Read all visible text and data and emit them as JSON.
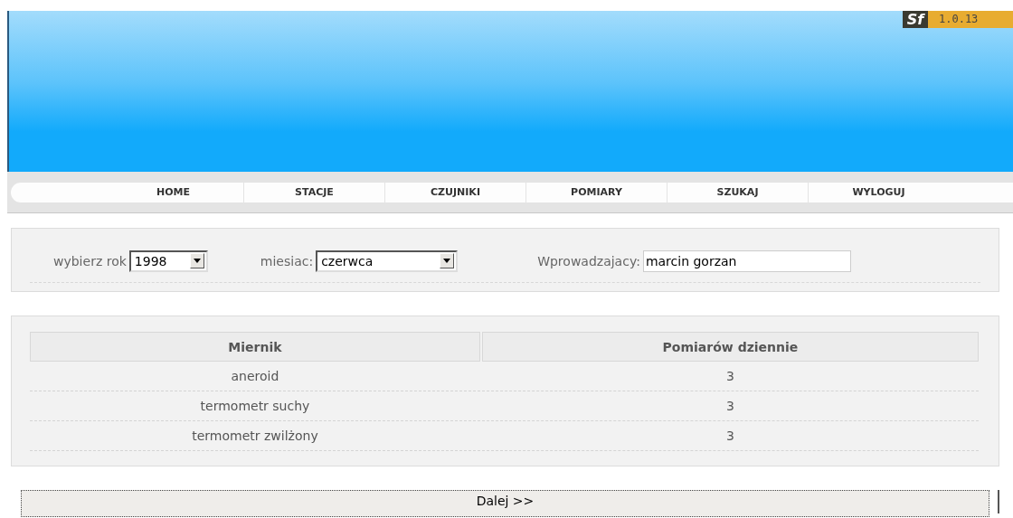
{
  "header": {
    "logo": "Sf",
    "version": "1.0.13"
  },
  "nav": [
    {
      "label": "HOME"
    },
    {
      "label": "STACJE"
    },
    {
      "label": "CZUJNIKI"
    },
    {
      "label": "POMIARY"
    },
    {
      "label": "SZUKAJ"
    },
    {
      "label": "WYLOGUJ"
    }
  ],
  "filters": {
    "year": {
      "label": "wybierz rok",
      "value": "1998"
    },
    "month": {
      "label": "miesiac:",
      "value": "czerwca"
    },
    "entered_by": {
      "label": "Wprowadzajacy:",
      "value": "marcin gorzan"
    }
  },
  "table": {
    "columns": [
      "Miernik",
      "Pomiarów dziennie"
    ],
    "rows": [
      [
        "aneroid",
        "3"
      ],
      [
        "termometr suchy",
        "3"
      ],
      [
        "termometr zwilżony",
        "3"
      ]
    ]
  },
  "next_button": "Dalej >>"
}
